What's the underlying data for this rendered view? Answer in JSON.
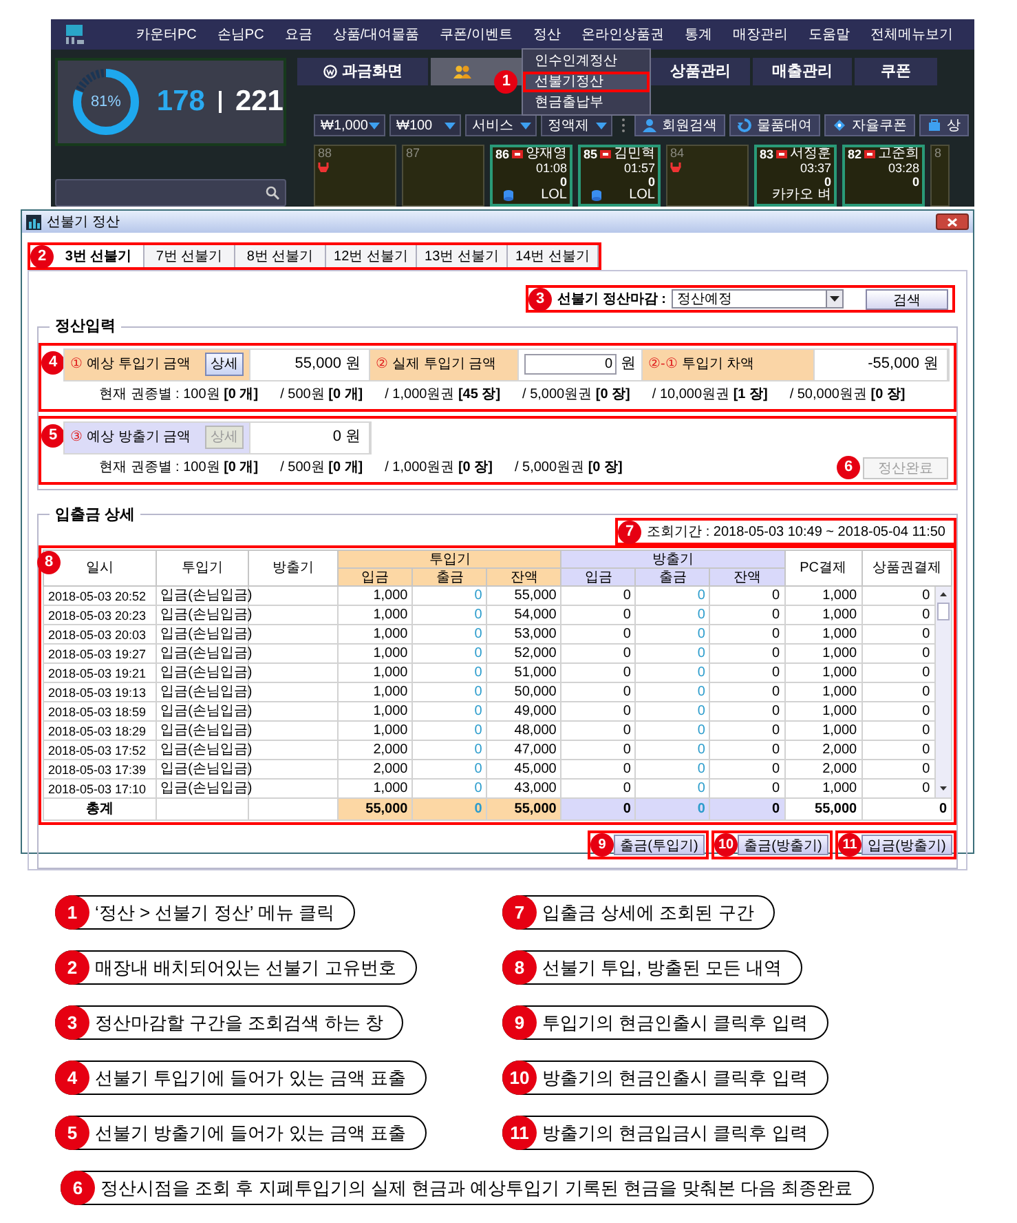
{
  "app": {
    "menu": [
      {
        "label": "카운터PC"
      },
      {
        "label": "손님PC"
      },
      {
        "label": "요금"
      },
      {
        "label": "상품/대여물품"
      },
      {
        "label": "쿠폰/이벤트"
      },
      {
        "label": "정산",
        "dropdown": {
          "badge": "1",
          "items": [
            {
              "label": "인수인계정산",
              "selected": false
            },
            {
              "label": "선불기정산",
              "selected": true
            },
            {
              "label": "현금출납부",
              "selected": false
            }
          ]
        }
      },
      {
        "label": "온라인상품권"
      },
      {
        "label": "통계"
      },
      {
        "label": "매장관리"
      },
      {
        "label": "도움말"
      },
      {
        "label": "전체메뉴보기"
      }
    ],
    "gauge": {
      "label": "81%",
      "level": 0.81
    },
    "seat_count": {
      "used": "178",
      "total": "221"
    },
    "tabs": [
      {
        "label": "과금화면",
        "selected": false
      },
      {
        "selected": true
      },
      {
        "label": "상품관리",
        "selected": false
      },
      {
        "label": "매출관리",
        "selected": false
      },
      {
        "label": "쿠폰",
        "selected": false
      }
    ],
    "toolbar": {
      "selects": [
        "₩1,000",
        "₩100",
        "서비스",
        "정액제"
      ],
      "buttons": [
        "회원검색",
        "물품대여",
        "자율쿠폰",
        "상"
      ]
    },
    "seats": [
      {
        "number": "88",
        "kind": "empty",
        "warning": true
      },
      {
        "number": "87",
        "kind": "empty",
        "warning": false
      },
      {
        "number": "86",
        "kind": "occupied",
        "name": "양재영",
        "time": "01:08",
        "amount": "0",
        "game": "LOL",
        "app_icon": true
      },
      {
        "number": "85",
        "kind": "occupied",
        "name": "김민혁",
        "time": "01:57",
        "amount": "0",
        "game": "LOL",
        "app_icon": true
      },
      {
        "number": "84",
        "kind": "empty",
        "warning": true
      },
      {
        "number": "83",
        "kind": "occupied",
        "name": "서정훈",
        "time": "03:37",
        "amount": "0",
        "game": "카카오 벼",
        "app_icon": false
      },
      {
        "number": "82",
        "kind": "occupied",
        "name": "고준희",
        "time": "03:28",
        "amount": "0",
        "app_icon": false
      },
      {
        "number": "8",
        "kind": "empty",
        "warning": false
      }
    ]
  },
  "dialog": {
    "title": "선불기 정산",
    "tabs_badge": "2",
    "tabs": [
      {
        "label": "3번 선불기",
        "selected": true
      },
      {
        "label": "7번 선불기",
        "selected": false
      },
      {
        "label": "8번 선불기",
        "selected": false
      },
      {
        "label": "12번 선불기",
        "selected": false
      },
      {
        "label": "13번 선불기",
        "selected": false
      },
      {
        "label": "14번 선불기",
        "selected": false
      }
    ],
    "search": {
      "badge": "3",
      "label": "선불기 정산마감 :",
      "select": "정산예정",
      "button": "검색"
    },
    "input_group": {
      "title": "정산입력",
      "inserter": {
        "badge": "4",
        "cells": [
          {
            "kind": "label",
            "mark": "①",
            "label": "예상 투입기 금액",
            "button": {
              "label": "상세",
              "disabled": false
            }
          },
          {
            "kind": "value",
            "value": "55,000 원"
          },
          {
            "kind": "label",
            "mark": "②",
            "label": "실제 투입기 금액"
          },
          {
            "kind": "input",
            "value": "0",
            "unit": "원"
          },
          {
            "kind": "label",
            "mark": "②-①",
            "label": "투입기 차액"
          },
          {
            "kind": "value",
            "value": "-55,000 원"
          }
        ],
        "denominations": [
          "현재 권종별 : 100원 **[0 개]**",
          "/ 500원 **[0 개]**",
          "/ 1,000원권 **[45 장]**",
          "/ 5,000원권 **[0 장]**",
          "/ 10,000원권 **[1 장]**",
          "/ 50,000원권 **[0 장]**"
        ]
      },
      "dispenser": {
        "badge": "5",
        "cells": [
          {
            "kind": "label",
            "mark": "③",
            "label": "예상 방출기 금액",
            "button": {
              "label": "상세",
              "disabled": true
            }
          },
          {
            "kind": "value",
            "value": "0 원"
          }
        ],
        "denominations": [
          "현재 권종별 : 100원 **[0 개]**",
          "/ 500원 **[0 개]**",
          "/ 1,000원권 **[0 장]**",
          "/ 5,000원권 **[0 장]**"
        ]
      },
      "complete_button": {
        "label": "정산완료",
        "disabled": true,
        "badge": "6"
      }
    },
    "detail_group": {
      "title": "입출금 상세",
      "period": {
        "badge": "7",
        "text": "조회기간 : 2018-05-03 10:49 ~ 2018-05-04 11:50"
      },
      "table": {
        "badge": "8",
        "columns": [
          {
            "label": "일시"
          },
          {
            "label": "투입기"
          },
          {
            "label": "방출기"
          },
          {
            "label": "투입기",
            "subcolumns": [
              "입금",
              "출금",
              "잔액"
            ]
          },
          {
            "label": "방출기",
            "subcolumns": [
              "입금",
              "출금",
              "잔액"
            ]
          },
          {
            "label": "PC결제"
          },
          {
            "label": "상품권결제"
          }
        ],
        "rows": [
          {
            "date": "2018-05-03 20:52",
            "inserter": "입금(손님입금)",
            "values": [
              "1,000",
              "0",
              "55,000",
              "0",
              "0",
              "0",
              "1,000",
              "0"
            ]
          },
          {
            "date": "2018-05-03 20:23",
            "inserter": "입금(손님입금)",
            "values": [
              "1,000",
              "0",
              "54,000",
              "0",
              "0",
              "0",
              "1,000",
              "0"
            ]
          },
          {
            "date": "2018-05-03 20:03",
            "inserter": "입금(손님입금)",
            "values": [
              "1,000",
              "0",
              "53,000",
              "0",
              "0",
              "0",
              "1,000",
              "0"
            ]
          },
          {
            "date": "2018-05-03 19:27",
            "inserter": "입금(손님입금)",
            "values": [
              "1,000",
              "0",
              "52,000",
              "0",
              "0",
              "0",
              "1,000",
              "0"
            ]
          },
          {
            "date": "2018-05-03 19:21",
            "inserter": "입금(손님입금)",
            "values": [
              "1,000",
              "0",
              "51,000",
              "0",
              "0",
              "0",
              "1,000",
              "0"
            ]
          },
          {
            "date": "2018-05-03 19:13",
            "inserter": "입금(손님입금)",
            "values": [
              "1,000",
              "0",
              "50,000",
              "0",
              "0",
              "0",
              "1,000",
              "0"
            ]
          },
          {
            "date": "2018-05-03 18:59",
            "inserter": "입금(손님입금)",
            "values": [
              "1,000",
              "0",
              "49,000",
              "0",
              "0",
              "0",
              "1,000",
              "0"
            ]
          },
          {
            "date": "2018-05-03 18:29",
            "inserter": "입금(손님입금)",
            "values": [
              "1,000",
              "0",
              "48,000",
              "0",
              "0",
              "0",
              "1,000",
              "0"
            ]
          },
          {
            "date": "2018-05-03 17:52",
            "inserter": "입금(손님입금)",
            "values": [
              "2,000",
              "0",
              "47,000",
              "0",
              "0",
              "0",
              "2,000",
              "0"
            ]
          },
          {
            "date": "2018-05-03 17:39",
            "inserter": "입금(손님입금)",
            "values": [
              "2,000",
              "0",
              "45,000",
              "0",
              "0",
              "0",
              "2,000",
              "0"
            ]
          },
          {
            "date": "2018-05-03 17:10",
            "inserter": "입금(손님입금)",
            "values": [
              "1,000",
              "0",
              "43,000",
              "0",
              "0",
              "0",
              "1,000",
              "0"
            ]
          }
        ],
        "total": {
          "label": "총계",
          "values": [
            "55,000",
            "0",
            "55,000",
            "0",
            "0",
            "0",
            "55,000",
            "0"
          ]
        }
      },
      "buttons": [
        {
          "label": "출금(투입기)",
          "badge": "9"
        },
        {
          "label": "출금(방출기)",
          "badge": "10"
        },
        {
          "label": "입금(방출기)",
          "badge": "11"
        }
      ]
    }
  },
  "callouts": [
    {
      "number": "1",
      "text": "‘정산 > 선불기 정산’ 메뉴 클릭"
    },
    {
      "number": "7",
      "text": "입출금 상세에 조회된 구간"
    },
    {
      "number": "2",
      "text": "매장내 배치되어있는 선불기 고유번호"
    },
    {
      "number": "8",
      "text": "선불기 투입, 방출된 모든 내역"
    },
    {
      "number": "3",
      "text": "정산마감할 구간을 조회검색 하는 창"
    },
    {
      "number": "9",
      "text": "투입기의 현금인출시 클릭후 입력"
    },
    {
      "number": "4",
      "text": "선불기 투입기에 들어가 있는 금액 표출"
    },
    {
      "number": "10",
      "text": "방출기의 현금인출시 클릭후 입력"
    },
    {
      "number": "5",
      "text": "선불기 방출기에 들어가 있는 금액 표출"
    },
    {
      "number": "11",
      "text": "방출기의 현금입금시 클릭후 입력"
    },
    {
      "number": "6",
      "text": "정산시점을 조회 후 지폐투입기의 실제 현금과 예상투입기 기록된 현금을 맞춰본 다음 최종완료"
    }
  ]
}
